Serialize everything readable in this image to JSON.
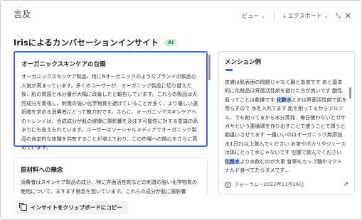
{
  "header": {
    "title": "言及"
  },
  "toolbar": {
    "view_label": "ビュー",
    "export_label": "エクスポート",
    "icons": [
      "chevron-down-icon",
      "export-icon",
      "expand-icon",
      "close-icon"
    ],
    "close_glyph": "✕",
    "expand_glyph": "⤡",
    "export_glyph": "⤓"
  },
  "page": {
    "title": "Irisによるカンバセーションインサイト",
    "ai_badge": "AI"
  },
  "insights": [
    {
      "title": "オーガニックスキンケアの台頭",
      "body": "オーガニックスキンケア製品、特にNオーガニックのようなブランドの製品の人気が高まっています。多くのユーザーが、オーガニック製品に切り替えた後、肌の質感と水分量が大幅に改善したと報告しています。これらの製品は天然成分を重視し、刺激の強い化学物質を避けていることが多く、より優しい選択肢を求める消費者にとって魅力的です。さらに、オーガニックスキンケアへのトレンドは、合成成分が肌の健康に悪影響を及ぼす可能性に対する意識の高まりにも支えられています。ユーザーはソーシャルメディアでオーガニック製品の肯定的な体験を共有することが増えており、この市場への関心をさらに高めています。"
    },
    {
      "title": "原材料への懸念",
      "body": "消費者はスキンケア製品の成分、特に界面活性剤などの刺激の強い化学物質の使用について、ますます懸念を抱いています。これらの成分が肌に悪影響"
    }
  ],
  "copy_button": {
    "label": "インサイトをクリップボードにコピー"
  },
  "mention": {
    "title": "メンション例",
    "before": "皮膚は肌表面の問題じゃなく腸と血液です あと基本的に化粧品は界面活性剤を避けた方が良いです 脂性肌ってことは乾燥です ",
    "highlight1": "化粧水",
    "middle": "とかは界面活性剤で肌を荒らすので 水を入れてます 肌を削ってるからツルツル、でも削ってるから水分蒸発、毎日使わないとガサガサという悪循環を作り出すことで使うことで潤うと勘違いさせてます 一番いいのはオーガニック無添加 水1日2L以上飲んでください お茶やポカリやジュースは体にとって水じゃないです 空腹で飲んでください ",
    "highlight2": "化粧水",
    "after": "より水飲むのが大事 食事もカップ麺やマクドナルド食べてたらダメです…",
    "source": "フォーラム・2023年11月26日",
    "icons": [
      "globe-icon",
      "external-link-icon"
    ],
    "external_glyph": "↗"
  }
}
